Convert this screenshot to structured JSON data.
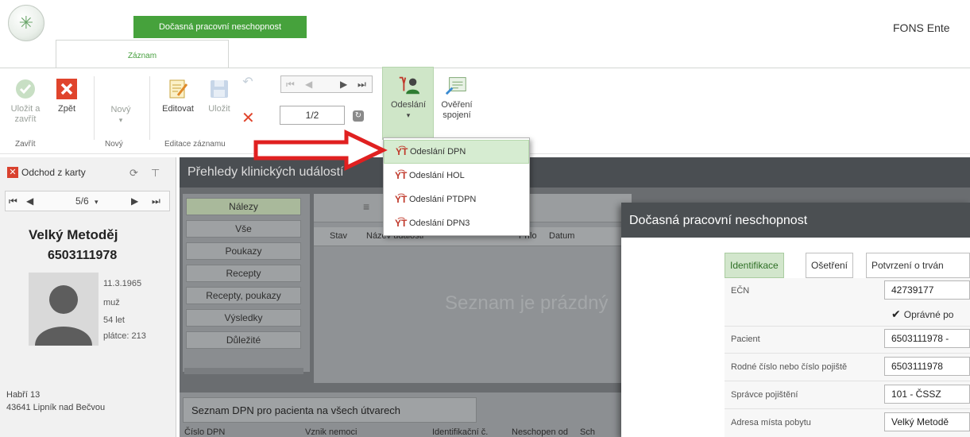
{
  "window": {
    "app_title": "FONS Ente",
    "context_tab": "Dočasná pracovní neschopnost",
    "ribbon_tab": "Záznam"
  },
  "ribbon": {
    "close_group": {
      "save_close": "Uložit a zavřít",
      "back": "Zpět",
      "label": "Zavřít"
    },
    "new_group": {
      "new": "Nový",
      "label": "Nový"
    },
    "edit_group": {
      "edit": "Editovat",
      "save": "Uložit",
      "label": "Editace záznamu"
    },
    "navigation": {
      "page": "1/2"
    },
    "send": {
      "label": "Odeslání"
    },
    "verify": {
      "label": "Ověření spojení"
    }
  },
  "dropdown": {
    "items": [
      {
        "label": "Odeslání DPN",
        "icon": "send-doc-icon"
      },
      {
        "label": "Odeslání HOL",
        "icon": "send-doc-icon"
      },
      {
        "label": "Odeslání PTDPN",
        "icon": "send-doc-icon"
      },
      {
        "label": "Odeslání DPN3",
        "icon": "send-doc-icon"
      }
    ]
  },
  "patient_panel": {
    "leave_card": "Odchod z karty",
    "record_pos": "5/6",
    "name": "Velký Metoděj",
    "id": "6503111978",
    "birth_date": "11.3.1965",
    "sex": "muž",
    "age": "54 let",
    "payer": "plátce: 213",
    "street": "Habří 13",
    "city": "43641 Lipník nad Bečvou"
  },
  "overview": {
    "title": "Přehledy klinických událostí",
    "filters": [
      "Nálezy",
      "Vše",
      "Poukazy",
      "Recepty",
      "Recepty, poukazy",
      "Výsledky",
      "Důležité"
    ],
    "columns": [
      "Stav",
      "Název události",
      "Přílo",
      "Datum"
    ],
    "empty": "Seznam je prázdný"
  },
  "dpn_list": {
    "tab": "Seznam DPN pro pacienta na všech útvarech",
    "columns": [
      "Číslo DPN",
      "Vznik nemoci",
      "Identifikační č.",
      "Neschopen od",
      "Sch"
    ]
  },
  "dialog": {
    "title": "Dočasná pracovní neschopnost",
    "tabs": [
      "Identifikace",
      "Ošetření",
      "Potvrzení o trván"
    ],
    "fields": [
      {
        "label": "EČN",
        "value": "42739177"
      },
      {
        "label": "Pacient",
        "value": "6503111978 -"
      },
      {
        "label": "Rodné číslo nebo číslo pojiště",
        "value": "6503111978"
      },
      {
        "label": "Správce pojištění",
        "value": "101 - ČSSZ"
      },
      {
        "label": "Adresa místa pobytu",
        "value": "Velký Metodě"
      }
    ],
    "checkbox": "Oprávné po"
  },
  "colors": {
    "accent_green": "#46a23c",
    "dark_header": "#4a4e52",
    "red_arrow": "#e02020"
  }
}
